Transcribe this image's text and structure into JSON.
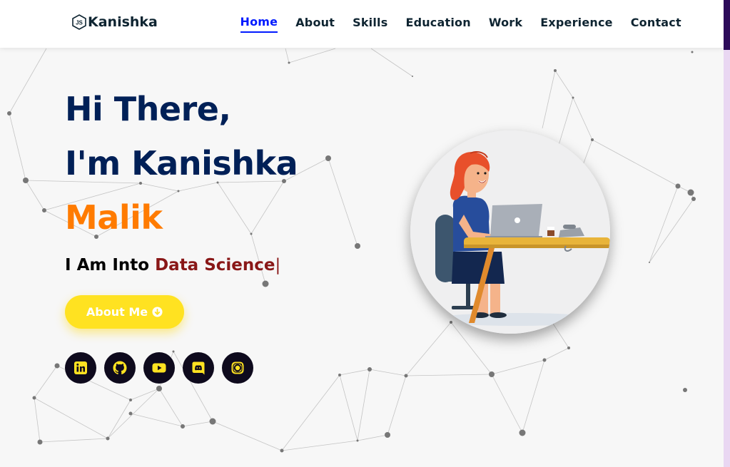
{
  "brand": {
    "name": "Kanishka",
    "icon": "js-hexagon-icon"
  },
  "nav": {
    "items": [
      {
        "label": "Home",
        "active": true
      },
      {
        "label": "About",
        "active": false
      },
      {
        "label": "Skills",
        "active": false
      },
      {
        "label": "Education",
        "active": false
      },
      {
        "label": "Work",
        "active": false
      },
      {
        "label": "Experience",
        "active": false
      },
      {
        "label": "Contact",
        "active": false
      }
    ]
  },
  "hero": {
    "line1": "Hi There,",
    "line2": "I'm Kanishka",
    "line3": "Malik",
    "typing_prefix": "I Am Into ",
    "typing_value": "Data Science",
    "typing_cursor": "|",
    "button_label": "About Me",
    "button_icon": "arrow-circle-down-icon",
    "socials": [
      {
        "name": "linkedin-icon"
      },
      {
        "name": "github-icon"
      },
      {
        "name": "youtube-icon"
      },
      {
        "name": "discord-icon"
      },
      {
        "name": "instagram-icon"
      }
    ],
    "image": "woman-working-on-laptop-illustration"
  },
  "colors": {
    "title": "#002057",
    "accent_orange": "#ff7b00",
    "typed_text": "#891717",
    "button": "#ffe221",
    "social_bg": "#0e0a1d",
    "social_icon": "#ffe221",
    "nav_active": "#011aff"
  }
}
